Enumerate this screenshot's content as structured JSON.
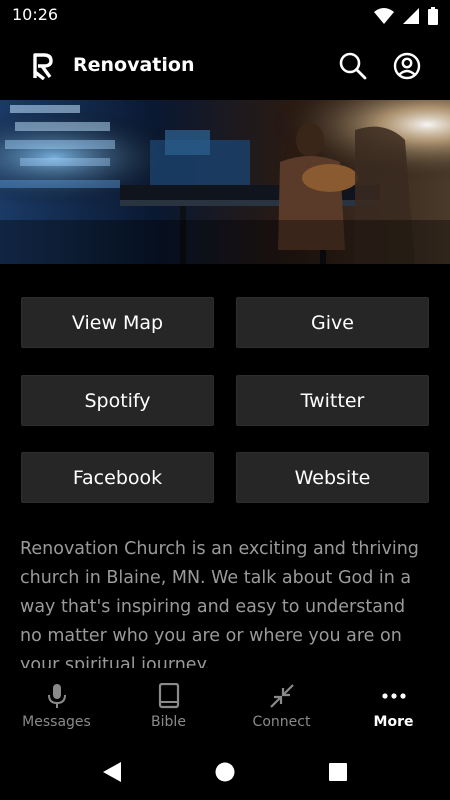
{
  "status_bar": {
    "time": "10:26"
  },
  "app_bar": {
    "title": "Renovation"
  },
  "hero": {
    "alt": "band performing on stage"
  },
  "actions": [
    {
      "label": "View Map"
    },
    {
      "label": "Give"
    },
    {
      "label": "Spotify"
    },
    {
      "label": "Twitter"
    },
    {
      "label": "Facebook"
    },
    {
      "label": "Website"
    }
  ],
  "description": "Renovation Church is an exciting and thriving church in Blaine, MN. We talk about God in a way that's inspiring and easy to understand no matter who you are or where you are on your spiritual journey.",
  "bottom_nav": [
    {
      "label": "Messages",
      "icon": "microphone-icon"
    },
    {
      "label": "Bible",
      "icon": "book-icon"
    },
    {
      "label": "Connect",
      "icon": "collapse-arrows-icon"
    },
    {
      "label": "More",
      "icon": "more-dots-icon",
      "active": true
    }
  ],
  "colors": {
    "background": "#000000",
    "button": "#262626",
    "text_muted": "#9a9a9a"
  }
}
